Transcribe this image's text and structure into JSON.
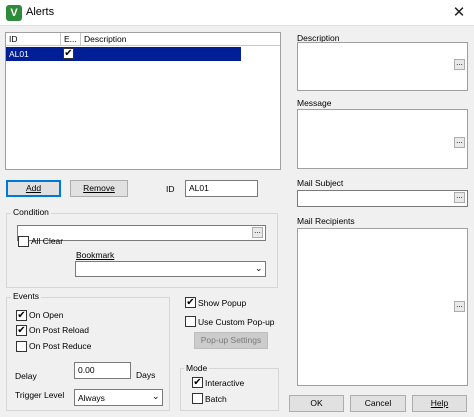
{
  "window": {
    "title": "Alerts",
    "app_icon_letter": "V",
    "close_glyph": "✕"
  },
  "grid": {
    "columns": [
      "ID",
      "E...",
      "Description"
    ],
    "rows": [
      {
        "id": "AL01",
        "enabled": true,
        "description": ""
      }
    ]
  },
  "buttons": {
    "add": "Add",
    "remove": "Remove",
    "popup_settings": "Pop-up Settings",
    "ok": "OK",
    "cancel": "Cancel",
    "help": "Help"
  },
  "id_field": {
    "label": "ID",
    "value": "AL01"
  },
  "condition": {
    "group_label": "Condition",
    "value": "",
    "bookmark_label": "Bookmark",
    "bookmark_value": "",
    "all_clear_label": "All Clear",
    "all_clear_checked": false
  },
  "events": {
    "group_label": "Events",
    "on_open": {
      "label": "On Open",
      "checked": true
    },
    "on_post_reload": {
      "label": "On Post Reload",
      "checked": true
    },
    "on_post_reduce": {
      "label": "On Post Reduce",
      "checked": false
    },
    "delay_label": "Delay",
    "delay_value": "0.00",
    "delay_unit": "Days",
    "trigger_label": "Trigger Level",
    "trigger_value": "Always"
  },
  "popup": {
    "show_popup": {
      "label": "Show Popup",
      "checked": true
    },
    "custom_popup": {
      "label": "Use Custom Pop-up",
      "checked": false
    }
  },
  "mode": {
    "group_label": "Mode",
    "interactive": {
      "label": "Interactive",
      "checked": true
    },
    "batch": {
      "label": "Batch",
      "checked": false
    }
  },
  "right": {
    "description_label": "Description",
    "message_label": "Message",
    "mail_subject_label": "Mail Subject",
    "mail_recipients_label": "Mail Recipients",
    "ellipsis": "..."
  },
  "icons": {
    "dropdown": "chevron-down-icon",
    "check": "check-icon"
  }
}
